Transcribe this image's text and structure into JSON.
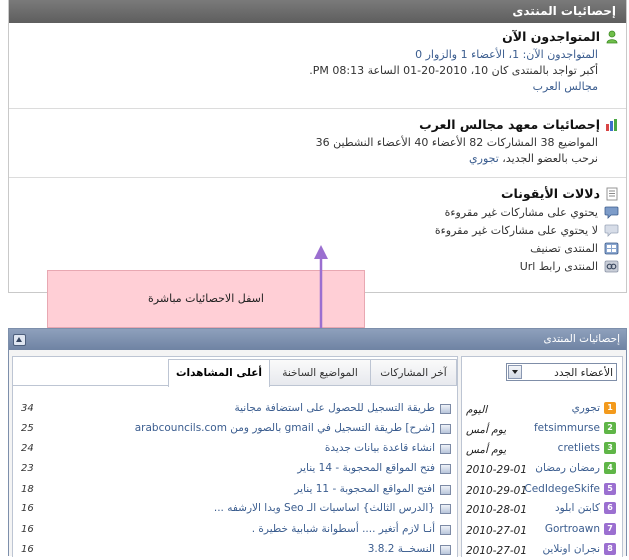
{
  "stats_panel": {
    "title": "إحصائيات المنتدى",
    "online": {
      "heading": "المتواجدون الآن",
      "line1": "المتواجدون الآن: 1، الأعضاء 1 والزوار 0",
      "line2": "أكبر تواجد بالمنتدى كان 10، 2010-20-01 الساعة 08:13 PM.",
      "link": "مجالس العرب"
    },
    "forum_stats": {
      "heading": "إحصائيات معهد مجالس العرب",
      "line1": "المواضيع  38 المشاركات  82 الأعضاء  40 الأعضاء النشطين  36",
      "welcome_prefix": "نرحب بالعضو الجديد، ",
      "new_member": "تجوري"
    },
    "legend": {
      "heading": "دلالات الأيقونات",
      "items": [
        {
          "label": "يحتوي على مشاركات غير مقروءة",
          "icon": "speech-bubble-icon"
        },
        {
          "label": "لا يحتوي على مشاركات غير مقروءة",
          "icon": "speech-bubble-faded-icon"
        },
        {
          "label": "المنتدى تصنيف",
          "icon": "category-icon"
        },
        {
          "label": "المنتدى رابط Url",
          "icon": "link-icon"
        }
      ]
    }
  },
  "annotation": {
    "text": "اسفل الاحصائيات مباشرة"
  },
  "forum_stats_box": {
    "title": "إحصائيات المنتدى",
    "members_select": "الأعضاء الجدد",
    "members": [
      {
        "rank": "1",
        "name": "تجوري",
        "date": "اليوم",
        "color": "#f39a1c"
      },
      {
        "rank": "2",
        "name": "fetsimmurse",
        "date": "يوم أمس",
        "color": "#5fb547"
      },
      {
        "rank": "3",
        "name": "cretliets",
        "date": "يوم أمس",
        "color": "#5fb547"
      },
      {
        "rank": "4",
        "name": "رمضان رمضان",
        "date": "2010-29-01",
        "color": "#5fb547"
      },
      {
        "rank": "5",
        "name": "CedIdegeSkife",
        "date": "2010-29-01",
        "color": "#9b6fd0"
      },
      {
        "rank": "6",
        "name": "كابتن ابلود",
        "date": "2010-28-01",
        "color": "#9b6fd0"
      },
      {
        "rank": "7",
        "name": "Gortroawn",
        "date": "2010-27-01",
        "color": "#9b6fd0"
      },
      {
        "rank": "8",
        "name": "نجران اونلاين",
        "date": "2010-27-01",
        "color": "#9b6fd0"
      }
    ],
    "tabs": [
      "أعلى المشاهدات",
      "المواضيع الساخنة",
      "آخر المشاركات"
    ],
    "threads": [
      {
        "title": "طريقة التسجيل للحصول على استضافة مجانية",
        "views": "34"
      },
      {
        "title": "[شرح] طريقة التسجيل في gmail بالصور ومن arabcouncils.com",
        "views": "25"
      },
      {
        "title": "انشاء قاعدة بيانات جديدة",
        "views": "24"
      },
      {
        "title": "فتح المواقع المحجوبة - 14 يناير",
        "views": "23"
      },
      {
        "title": "افتح المواقع المحجوبة - 11 يناير",
        "views": "18"
      },
      {
        "title": "{الدرس الثالث} اساسيات الـ Seo وبدا الارشفه ...",
        "views": "16"
      },
      {
        "title": "أنـا لازم أتغير .... أسطوانة شبابية خطيرة .",
        "views": "16"
      },
      {
        "title": "النسخــة 3.8.2",
        "views": "16"
      }
    ]
  }
}
